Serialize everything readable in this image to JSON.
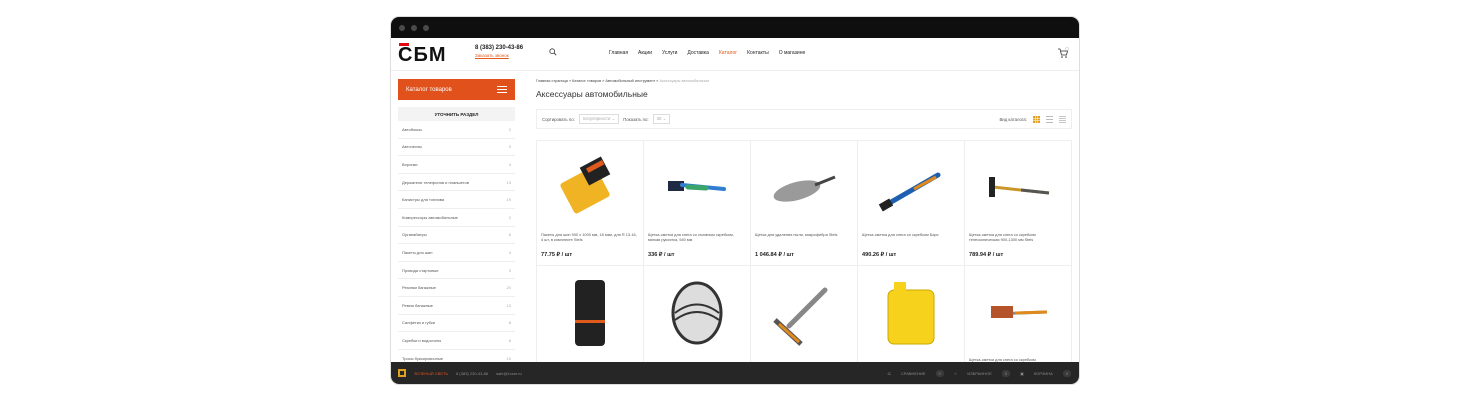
{
  "header": {
    "logo": "СБМ",
    "phone": "8 (383) 230-43-86",
    "callback": "Заказать звонок",
    "nav": [
      "Главная",
      "Акции",
      "Услуги",
      "Доставка",
      "Каталог",
      "Контакты",
      "О магазине"
    ],
    "active_nav": "Каталог"
  },
  "sidebar": {
    "catalog_button": "Каталог товаров",
    "refine_title": "УТОЧНИТЬ РАЗДЕЛ",
    "items": [
      {
        "label": "Автобоксы",
        "count": "2"
      },
      {
        "label": "Авточехлы",
        "count": "3"
      },
      {
        "label": "Воронки",
        "count": "4"
      },
      {
        "label": "Держатели телефонов и планшетов",
        "count": "13"
      },
      {
        "label": "Канистры для топлива",
        "count": "19"
      },
      {
        "label": "Компрессоры автомобильные",
        "count": "2"
      },
      {
        "label": "Органайзеры",
        "count": "6"
      },
      {
        "label": "Пакеты для шин",
        "count": "4"
      },
      {
        "label": "Провода стартовые",
        "count": "3"
      },
      {
        "label": "Резинки багажные",
        "count": "20"
      },
      {
        "label": "Ремни багажные",
        "count": "13"
      },
      {
        "label": "Салфетки и губки",
        "count": "8"
      },
      {
        "label": "Скребки и водосгоны",
        "count": "6"
      },
      {
        "label": "Тросы буксировочные",
        "count": "15"
      }
    ]
  },
  "main": {
    "breadcrumb": [
      "Главная страница",
      "Каталог товаров",
      "Автомобильный инструмент",
      "Аксессуары автомобильные"
    ],
    "breadcrumb_sep": "»",
    "title": "Аксессуары автомобильные",
    "sort_label": "Сортировать по:",
    "sort_value": "популярности",
    "show_label": "Показать по:",
    "show_value": "30",
    "view_label": "Вид каталога:"
  },
  "products": [
    {
      "name": "Пакеты для шин 900 х 1000 мм, 18 мкм, для R 13-16, 4 шт, в комплекте Stels",
      "price": "77.75 ₽ / шт",
      "icon": "tire-bags-icon"
    },
    {
      "name": "Щетка-сметка для снега со съемным скребком, мягкая рукоятка, 540 мм",
      "price": "336 ₽ / шт",
      "icon": "snow-brush-icon"
    },
    {
      "name": "Щетка для удаления пыли, микрофибра Stels",
      "price": "1 046.84 ₽ / шт",
      "icon": "duster-icon"
    },
    {
      "name": "Щетка-сметка для снега со скребком Барс",
      "price": "490.26 ₽ / шт",
      "icon": "snow-brush-scraper-icon"
    },
    {
      "name": "Щетка-сметка для снега со скребком телескопическая 900-1300 мм Stels",
      "price": "789.94 ₽ / шт",
      "icon": "telescopic-brush-icon"
    },
    {
      "name": "",
      "price": "",
      "icon": "sun-visor-organizer-icon"
    },
    {
      "name": "",
      "price": "",
      "icon": "back-support-icon"
    },
    {
      "name": "",
      "price": "",
      "icon": "squeegee-icon"
    },
    {
      "name": "",
      "price": "",
      "icon": "fuel-canister-icon"
    },
    {
      "name": "Щетка-сметка для снега со скребком",
      "price": "",
      "icon": "brush-scraper-icon"
    }
  ],
  "bottombar": {
    "brand": "ЗЕЛЕНЫЙ СВЕТЬ",
    "phone": "8 (383) 230-43-86",
    "email": "sale@1csm.ru",
    "compare": "СРАВНЕНИЕ",
    "compare_count": "0",
    "favorites": "ИЗБРАННОЕ",
    "favorites_count": "0",
    "cart": "КОРЗИНА",
    "cart_count": "0"
  },
  "colors": {
    "accent": "#e0511c",
    "logo_red": "#e30613",
    "bottombar": "#262626"
  }
}
